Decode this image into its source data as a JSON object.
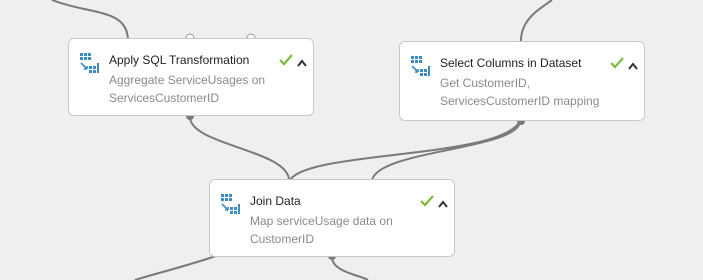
{
  "modules": [
    {
      "title": "Apply SQL Transformation",
      "description_line1": "Aggregate ServiceUsages on",
      "description_line2": "ServicesCustomerID",
      "status": "completed"
    },
    {
      "title": "Select Columns in Dataset",
      "description_line1": "Get CustomerID,",
      "description_line2": "ServicesCustomerID mapping",
      "status": "completed"
    },
    {
      "title": "Join Data",
      "description_line1": "Map serviceUsage data on",
      "description_line2": "CustomerID",
      "status": "completed"
    }
  ],
  "icons": {
    "module": "module-table-icon",
    "status": "checkmark-icon",
    "collapse": "chevron-up-icon"
  },
  "colors": {
    "canvas": "#efefef",
    "module_border": "#c8c8c8",
    "wire": "#7a7a7a",
    "success": "#7cbb3a",
    "icon_blue": "#3b8cc5"
  }
}
